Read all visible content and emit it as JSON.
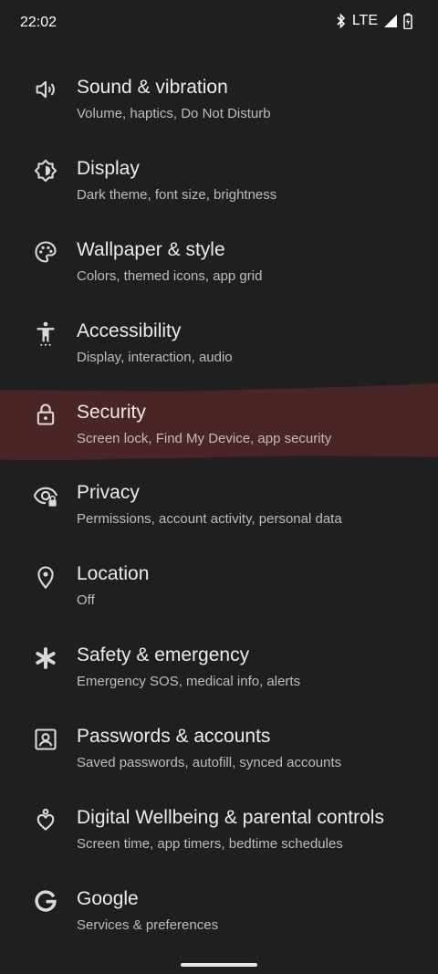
{
  "status_bar": {
    "time": "22:02",
    "network": "LTE"
  },
  "colors": {
    "background": "#1f1f21",
    "highlight": "#4a2526",
    "icon": "#d9d9d9"
  },
  "settings": [
    {
      "title": "Sound & vibration",
      "subtitle": "Volume, haptics, Do Not Disturb",
      "icon": "speaker-icon"
    },
    {
      "title": "Display",
      "subtitle": "Dark theme, font size, brightness",
      "icon": "brightness-icon"
    },
    {
      "title": "Wallpaper & style",
      "subtitle": "Colors, themed icons, app grid",
      "icon": "palette-icon"
    },
    {
      "title": "Accessibility",
      "subtitle": "Display, interaction, audio",
      "icon": "accessibility-icon"
    },
    {
      "title": "Security",
      "subtitle": "Screen lock, Find My Device, app security",
      "icon": "lock-icon"
    },
    {
      "title": "Privacy",
      "subtitle": "Permissions, account activity, personal data",
      "icon": "eye-lock-icon"
    },
    {
      "title": "Location",
      "subtitle": "Off",
      "icon": "location-pin-icon"
    },
    {
      "title": "Safety & emergency",
      "subtitle": "Emergency SOS, medical info, alerts",
      "icon": "asterisk-icon"
    },
    {
      "title": "Passwords & accounts",
      "subtitle": "Saved passwords, autofill, synced accounts",
      "icon": "account-box-icon"
    },
    {
      "title": "Digital Wellbeing & parental controls",
      "subtitle": "Screen time, app timers, bedtime schedules",
      "icon": "wellbeing-heart-icon"
    },
    {
      "title": "Google",
      "subtitle": "Services & preferences",
      "icon": "google-g-icon"
    }
  ]
}
